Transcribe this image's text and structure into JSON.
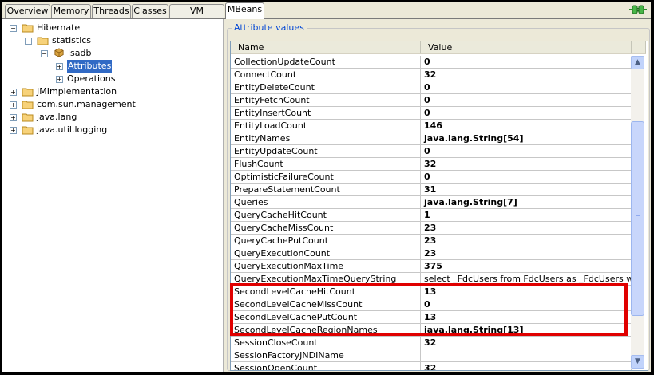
{
  "tabs": [
    {
      "label": "Overview"
    },
    {
      "label": "Memory"
    },
    {
      "label": "Threads"
    },
    {
      "label": "Classes"
    },
    {
      "label": "VM Summary"
    },
    {
      "label": "MBeans"
    }
  ],
  "active_tab": "MBeans",
  "connection_icon": "plug-icon",
  "tree": {
    "root": "Hibernate",
    "child": "statistics",
    "bean": "lsadb",
    "attributes": "Attributes",
    "operations": "Operations",
    "others": [
      "JMImplementation",
      "com.sun.management",
      "java.lang",
      "java.util.logging"
    ]
  },
  "panel": {
    "title": "Attribute values",
    "col_name": "Name",
    "col_value": "Value"
  },
  "rows": [
    {
      "name": "CollectionUpdateCount",
      "value": "0"
    },
    {
      "name": "ConnectCount",
      "value": "32"
    },
    {
      "name": "EntityDeleteCount",
      "value": "0"
    },
    {
      "name": "EntityFetchCount",
      "value": "0"
    },
    {
      "name": "EntityInsertCount",
      "value": "0"
    },
    {
      "name": "EntityLoadCount",
      "value": "146"
    },
    {
      "name": "EntityNames",
      "value": "java.lang.String[54]"
    },
    {
      "name": "EntityUpdateCount",
      "value": "0"
    },
    {
      "name": "FlushCount",
      "value": "32"
    },
    {
      "name": "OptimisticFailureCount",
      "value": "0"
    },
    {
      "name": "PrepareStatementCount",
      "value": "31"
    },
    {
      "name": "Queries",
      "value": "java.lang.String[7]"
    },
    {
      "name": "QueryCacheHitCount",
      "value": "1"
    },
    {
      "name": "QueryCacheMissCount",
      "value": "23"
    },
    {
      "name": "QueryCachePutCount",
      "value": "23"
    },
    {
      "name": "QueryExecutionCount",
      "value": "23"
    },
    {
      "name": "QueryExecutionMaxTime",
      "value": "375"
    },
    {
      "name": "QueryExecutionMaxTimeQueryString",
      "value": "select _FdcUsers from FdcUsers as _FdcUsers wh..."
    },
    {
      "name": "SecondLevelCacheHitCount",
      "value": "13"
    },
    {
      "name": "SecondLevelCacheMissCount",
      "value": "0"
    },
    {
      "name": "SecondLevelCachePutCount",
      "value": "13"
    },
    {
      "name": "SecondLevelCacheRegionNames",
      "value": "java.lang.String[13]"
    },
    {
      "name": "SessionCloseCount",
      "value": "32"
    },
    {
      "name": "SessionFactoryJNDIName",
      "value": ""
    },
    {
      "name": "SessionOpenCount",
      "value": "32"
    }
  ],
  "scroll": {
    "up": "▲",
    "down": "▼"
  },
  "colors": {
    "highlight": "#e00000",
    "selection": "#316ac5",
    "title": "#0046d5"
  }
}
